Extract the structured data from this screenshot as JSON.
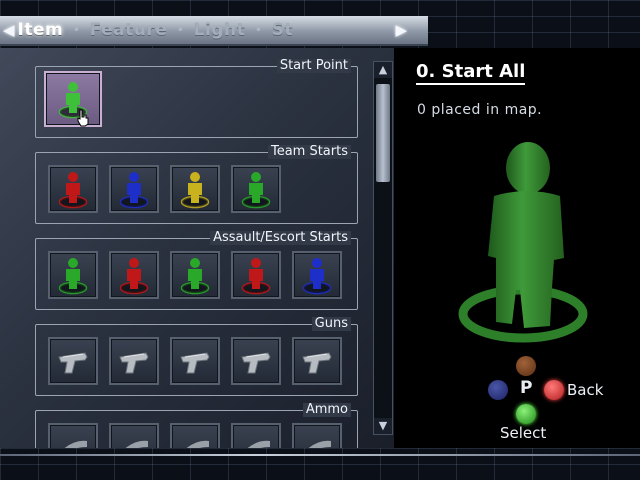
{
  "tabs": {
    "left_arrow": "◀",
    "right_arrow": "▶",
    "items": [
      {
        "label": "Item",
        "active": true
      },
      {
        "label": "Feature",
        "active": false
      },
      {
        "label": "Light",
        "active": false
      },
      {
        "label": "St",
        "active": false
      }
    ],
    "separator": "•"
  },
  "groups": [
    {
      "title": "Start Point",
      "slots": [
        {
          "icon": "figure-icon",
          "color": "#3fc03a",
          "selected": true
        }
      ]
    },
    {
      "title": "Team Starts",
      "slots": [
        {
          "icon": "figure-icon",
          "color": "#c01818"
        },
        {
          "icon": "figure-icon",
          "color": "#1e2ec8"
        },
        {
          "icon": "figure-icon",
          "color": "#c8b21e"
        },
        {
          "icon": "figure-icon",
          "color": "#2aa82a"
        }
      ]
    },
    {
      "title": "Assault/Escort Starts",
      "slots": [
        {
          "icon": "figure-icon",
          "color": "#2aa82a"
        },
        {
          "icon": "figure-icon",
          "color": "#c01818"
        },
        {
          "icon": "figure-icon",
          "color": "#2aa82a"
        },
        {
          "icon": "figure-icon",
          "color": "#c01818"
        },
        {
          "icon": "figure-icon",
          "color": "#1e2ec8"
        }
      ]
    },
    {
      "title": "Guns",
      "slots": [
        {
          "icon": "pistol-icon"
        },
        {
          "icon": "pistol-icon"
        },
        {
          "icon": "pistol-icon"
        },
        {
          "icon": "pistol-icon"
        },
        {
          "icon": "pistol-icon"
        }
      ]
    },
    {
      "title": "Ammo",
      "slots": [
        {
          "icon": "ammo-icon"
        },
        {
          "icon": "ammo-icon"
        },
        {
          "icon": "ammo-icon"
        },
        {
          "icon": "ammo-icon"
        },
        {
          "icon": "ammo-icon"
        }
      ]
    }
  ],
  "info": {
    "title": "0. Start All",
    "placed_text": "0 placed in map.",
    "model_color": "#3a8a36"
  },
  "hints": {
    "toggle_symbol": "P",
    "back_label": "Back",
    "select_label": "Select"
  },
  "scroll": {
    "up": "▲",
    "down": "▼"
  }
}
